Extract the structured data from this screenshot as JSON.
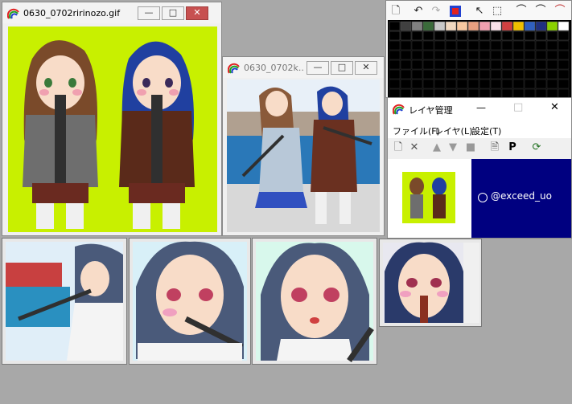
{
  "window_main": {
    "title": "0630_0702ririnozo.gif"
  },
  "window_scene": {
    "title": "0630_0702k..."
  },
  "window_layers": {
    "title": "レイヤ管理",
    "menu": [
      "ファイル(F)",
      "レイヤ(L)",
      "設定(T)"
    ],
    "layer_label": "@exceed_uo"
  },
  "palette": {
    "colors_row1": [
      "#000000",
      "#404040",
      "#808080",
      "#3a6b3a",
      "#c8c8c8",
      "#f0d8c0",
      "#f8c8a0",
      "#e8a080",
      "#f0a0b0",
      "#f8e0e8",
      "#d04040",
      "#f0c000",
      "#3060c0",
      "#203080",
      "#8ad000",
      "#ffffff"
    ],
    "colors_row2": [
      "#000000",
      "#000000",
      "#000000",
      "#000000",
      "#000000",
      "#000000",
      "#000000",
      "#000000",
      "#000000",
      "#000000",
      "#000000",
      "#000000",
      "#000000",
      "#000000",
      "#000000",
      "#000000"
    ]
  },
  "toolbar_icons": [
    "new-icon",
    "undo-icon",
    "redo-icon",
    "color-swap-icon",
    "pointer-icon",
    "marquee-icon",
    "headphone-icon",
    "headphone-alt-icon",
    "headphone-red-icon"
  ],
  "control_glyphs": {
    "minimize": "—",
    "maximize": "□",
    "close": "✕"
  }
}
